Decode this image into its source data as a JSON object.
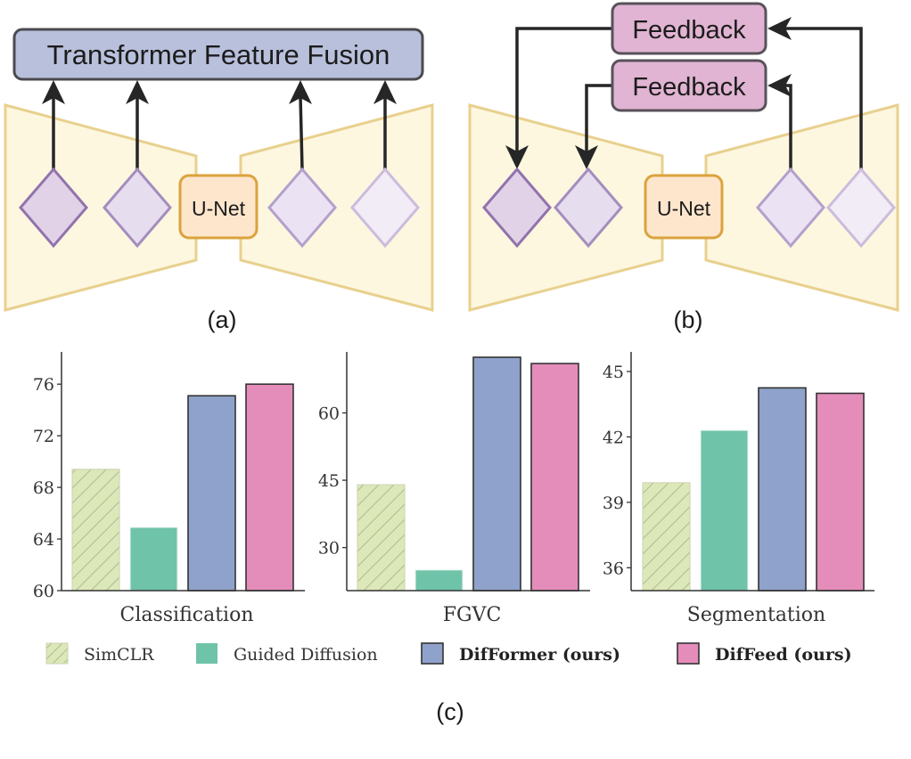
{
  "panel_a": {
    "top_box_label": "Transformer Feature Fusion",
    "center_label": "U-Net",
    "caption": "(a)",
    "colors": {
      "top_box_fill": "#b9c0dc",
      "top_box_stroke": "#4a4a4f",
      "trapezoid_fill": "#fdf7e0",
      "trapezoid_stroke": "#e8d08e",
      "unet_fill": "#fde6cc",
      "unet_stroke": "#dba33d"
    }
  },
  "panel_b": {
    "feedback_label_top": "Feedback",
    "feedback_label_bottom": "Feedback",
    "center_label": "U-Net",
    "caption": "(b)",
    "colors": {
      "feedback_fill": "#e0b4d2",
      "feedback_stroke": "#58525a"
    }
  },
  "diamond_colors": [
    {
      "fill": "#e1d2e8",
      "stroke": "#9273ac"
    },
    {
      "fill": "#e6ddef",
      "stroke": "#a58dbd"
    },
    {
      "fill": "#ebe3f3",
      "stroke": "#b4a0cb"
    },
    {
      "fill": "#f1ecf6",
      "stroke": "#ccbcdc"
    }
  ],
  "panel_c": {
    "caption": "(c)"
  },
  "chart_data": {
    "type": "bar",
    "series_names": [
      "SimCLR",
      "Guided Diffusion",
      "DifFormer (ours)",
      "DifFeed (ours)"
    ],
    "series_colors": [
      "#dde8b9",
      "#6fc3a8",
      "#8fa2cb",
      "#e58dba"
    ],
    "series_bold": [
      false,
      false,
      true,
      true
    ],
    "series_hatched": [
      true,
      false,
      false,
      false
    ],
    "series_outlined": [
      false,
      false,
      true,
      true
    ],
    "legend_position": "bottom",
    "grid": false,
    "subplots": [
      {
        "xlabel": "Classification",
        "ylim": [
          60,
          78.5
        ],
        "yticks": [
          60,
          64,
          68,
          72,
          76
        ],
        "values": [
          69.4,
          64.9,
          75.1,
          76.0
        ]
      },
      {
        "xlabel": "FGVC",
        "ylim": [
          20.4,
          73.6
        ],
        "yticks": [
          30,
          45,
          60
        ],
        "values": [
          44.0,
          25.0,
          72.4,
          71.0
        ]
      },
      {
        "xlabel": "Segmentation",
        "ylim": [
          34.95,
          45.9
        ],
        "yticks": [
          36,
          39,
          42,
          45
        ],
        "values": [
          39.9,
          42.3,
          44.25,
          44.0
        ]
      }
    ]
  }
}
